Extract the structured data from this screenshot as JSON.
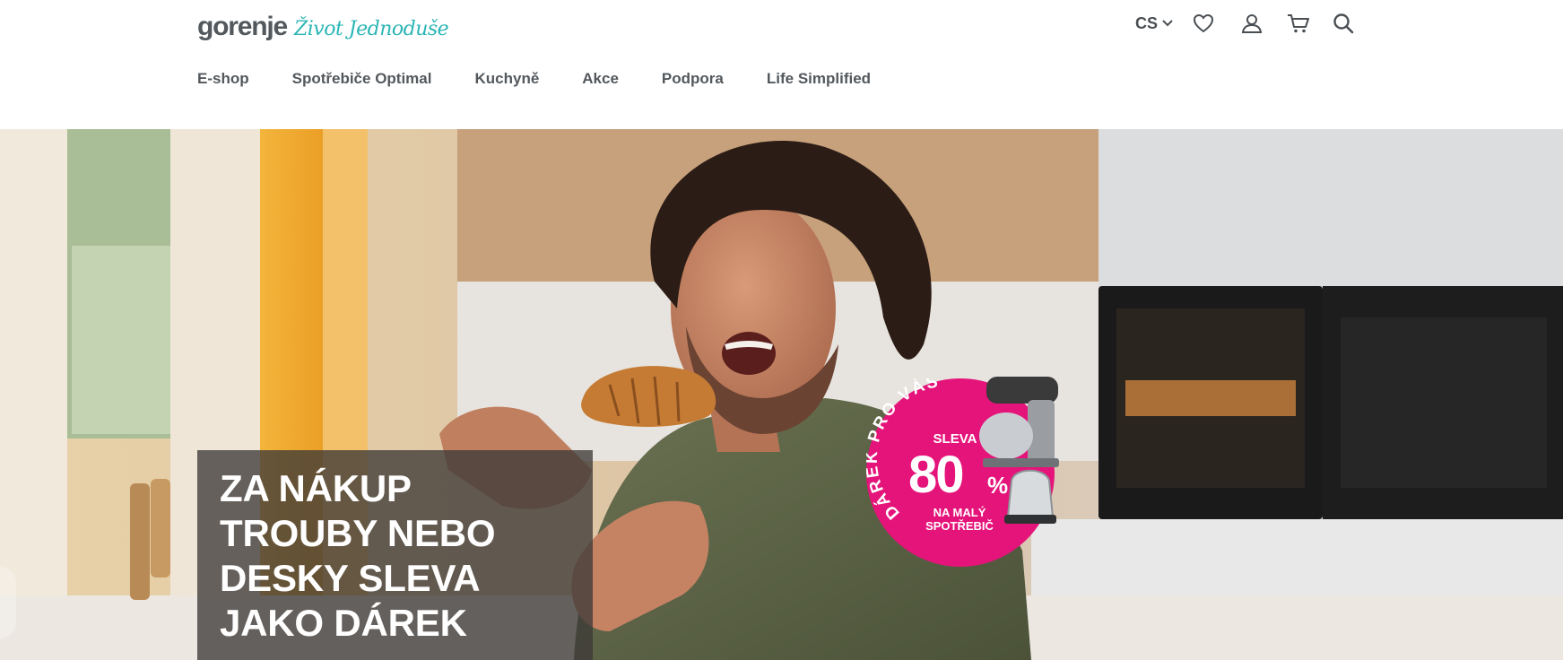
{
  "header": {
    "logo_word": "gorenje",
    "logo_slogan": "Život Jednoduše",
    "language": "CS",
    "icons": [
      "chevron-down-icon",
      "heart-icon",
      "user-icon",
      "cart-icon",
      "search-icon"
    ]
  },
  "nav": {
    "items": [
      {
        "label": "E-shop"
      },
      {
        "label": "Spotřebiče Optimal"
      },
      {
        "label": "Kuchyně"
      },
      {
        "label": "Akce"
      },
      {
        "label": "Podpora"
      },
      {
        "label": "Life Simplified"
      }
    ]
  },
  "hero": {
    "headline_lines": [
      "ZA NÁKUP",
      "TROUBY NEBO",
      "DESKY SLEVA",
      "JAKO DÁREK"
    ],
    "badge": {
      "arc_text": "DÁREK PRO VÁS",
      "sleva": "SLEVA",
      "value": "80",
      "unit": "%",
      "sub_line1": "NA MALÝ",
      "sub_line2": "SPOTŘEBIČ"
    }
  },
  "colors": {
    "logo_teal": "#2cb5b5",
    "text_grey": "#53585d",
    "badge_magenta": "#e5147a",
    "overlay": "#3e3a37"
  }
}
